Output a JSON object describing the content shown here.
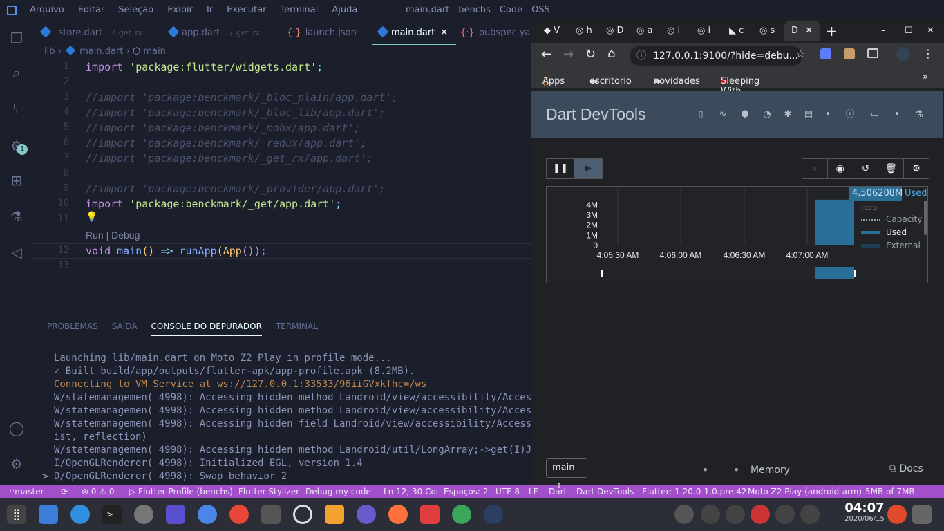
{
  "titlebar": {
    "menu": [
      "Arquivo",
      "Editar",
      "Seleção",
      "Exibir",
      "Ir",
      "Executar",
      "Terminal",
      "Ajuda"
    ],
    "window_title": "main.dart - benchs - Code - OSS"
  },
  "activity": {
    "debug_badge": "1"
  },
  "tabs": [
    {
      "label": "_store.dart",
      "sub": ".../_get_rx",
      "kind": "dart"
    },
    {
      "label": "app.dart",
      "sub": ".../_get_rx",
      "kind": "dart"
    },
    {
      "label": "launch.json",
      "sub": "",
      "kind": "json"
    },
    {
      "label": "main.dart",
      "sub": "",
      "kind": "dart",
      "active": true
    },
    {
      "label": "pubspec.yaml",
      "sub": "",
      "kind": "json"
    }
  ],
  "breadcrumb": {
    "p1": "lib",
    "p2": "main.dart",
    "p3": "main"
  },
  "code": {
    "lines": [
      "1",
      "2",
      "3",
      "4",
      "5",
      "6",
      "7",
      "8",
      "9",
      "10",
      "11",
      "12",
      "13"
    ],
    "l1_kw": "import",
    "l1_str": "'package:flutter/widgets.dart'",
    "l1_end": ";",
    "l3": "//import 'package:benckmark/_bloc_plain/app.dart';",
    "l4": "//import 'package:benckmark/_bloc_lib/app.dart';",
    "l5": "//import 'package:benckmark/_mobx/app.dart';",
    "l6": "//import 'package:benckmark/_redux/app.dart';",
    "l7": "//import 'package:benckmark/_get_rx/app.dart';",
    "l9": "//import 'package:benckmark/_provider/app.dart';",
    "l10_kw": "import",
    "l10_str": "'package:benckmark/_get/app.dart'",
    "l10_end": ";",
    "codelens": "Run | Debug",
    "l12_void": "void",
    "l12_main": "main",
    "l12_par": "()",
    "l12_arrow": "=>",
    "l12_run": "runApp",
    "l12_open": "(",
    "l12_app": "App",
    "l12_close": "());"
  },
  "panel": {
    "tabs": [
      "PROBLEMAS",
      "SAÍDA",
      "CONSOLE DO DEPURADOR",
      "TERMINAL"
    ],
    "console": [
      "Launching lib/main.dart on Moto Z2 Play in profile mode...",
      "✓ Built build/app/outputs/flutter-apk/app-profile.apk (8.2MB).",
      "Connecting to VM Service at ws://127.0.0.1:33533/96iiGVxkfhc=/ws",
      "W/statemanagemen( 4998): Accessing hidden method Landroid/view/accessibility/Acces",
      "W/statemanagemen( 4998): Accessing hidden method Landroid/view/accessibility/Acces",
      "W/statemanagemen( 4998): Accessing hidden field Landroid/view/accessibility/Access",
      "ist, reflection)",
      "W/statemanagemen( 4998): Accessing hidden method Landroid/util/LongArray;->get(I)J",
      "I/OpenGLRenderer( 4998): Initialized EGL, version 1.4",
      "D/OpenGLRenderer( 4998): Swap behavior 2"
    ],
    "prompt": ">"
  },
  "statusbar": {
    "branch": "master",
    "sync": "⟳",
    "errors": "⊗ 0 ⚠ 0",
    "profile": "▷ Flutter Profile (benchs)",
    "stylizer": "Flutter Stylizer",
    "debug_code": "Debug my code",
    "position": "Ln 12, 30 Col",
    "spaces": "Espaços: 2",
    "encoding": "UTF-8",
    "eol": "LF",
    "language": "Dart",
    "devtools": "Dart DevTools",
    "flutter": "Flutter: 1.20.0-1.0.pre.42",
    "device": "Moto Z2 Play (android-arm)",
    "memory": "5MB of 7MB"
  },
  "taskbar": {
    "time": "04:07",
    "date": "2020/06/15"
  },
  "chrome": {
    "tabs": [
      "V",
      "h",
      "D",
      "a",
      "i",
      "i",
      "c",
      "s"
    ],
    "active_tab": "D",
    "url": "127.0.0.1:9100/?hide=debu...",
    "bookmarks": [
      "Apps",
      "escritorio",
      "novidades",
      "Sleeping With Sire..."
    ],
    "more": "»"
  },
  "devtools": {
    "title": "Dart DevTools",
    "tooltip": "4.506208M",
    "tooltip_label": "Used",
    "footer_isolate": "main",
    "footer_page": "Memory",
    "footer_docs": "Docs"
  },
  "chart_data": {
    "type": "bar",
    "ylabel": "",
    "yticks": [
      "4M",
      "3M",
      "2M",
      "1M",
      "0"
    ],
    "xticks": [
      "4:05:30 AM",
      "4:06:00 AM",
      "4:06:30 AM",
      "4:07:00 AM"
    ],
    "legend": [
      "RSS",
      "Capacity",
      "Used",
      "External"
    ],
    "series": [
      {
        "name": "Used",
        "values": [
          4.506208
        ],
        "unit": "M"
      }
    ],
    "colors": {
      "used": "#2a6f97",
      "external": "#1e3d59",
      "capacity": "#9aa0a6"
    },
    "ylim": [
      0,
      4.7
    ]
  }
}
